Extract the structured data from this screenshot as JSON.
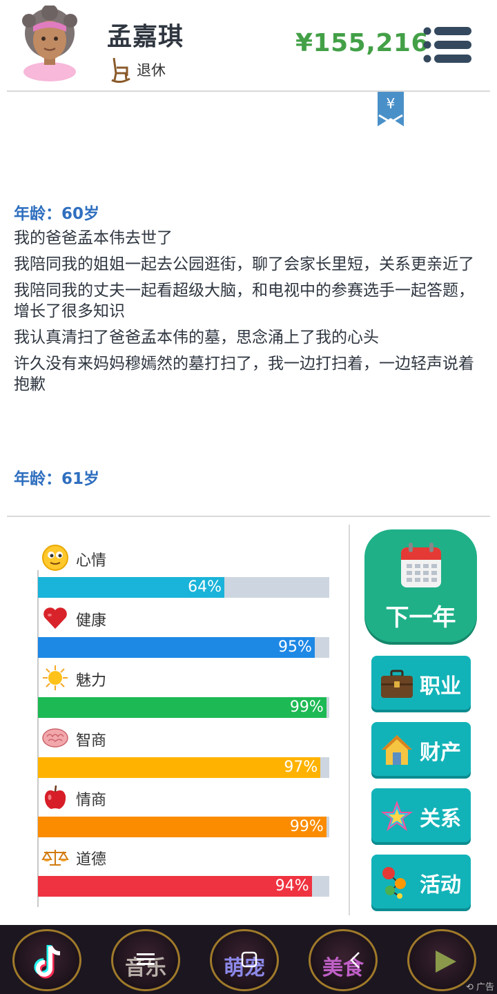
{
  "header": {
    "name": "孟嘉琪",
    "status": "退休",
    "money": "¥155,216"
  },
  "bookmark": {
    "symbol": "¥"
  },
  "log": {
    "blocks": [
      {
        "age": "年龄：60岁",
        "entries": [
          "我的爸爸孟本伟去世了",
          "我陪同我的姐姐一起去公园逛街，聊了会家长里短，关系更亲近了",
          "我陪同我的丈夫一起看超级大脑，和电视中的参赛选手一起答题，增长了很多知识",
          "我认真清扫了爸爸孟本伟的墓，思念涌上了我的心头",
          "许久没有来妈妈穆嫣然的墓打扫了，我一边打扫着，一边轻声说着抱歉"
        ]
      },
      {
        "age": "年龄：61岁"
      }
    ]
  },
  "stats": [
    {
      "label": "心情",
      "value": 64,
      "pct": "64%",
      "color": "#1ab3d9",
      "icon": "smiley-icon"
    },
    {
      "label": "健康",
      "value": 95,
      "pct": "95%",
      "color": "#1e88e5",
      "icon": "heart-icon"
    },
    {
      "label": "魅力",
      "value": 99,
      "pct": "99%",
      "color": "#1db954",
      "icon": "sun-icon"
    },
    {
      "label": "智商",
      "value": 97,
      "pct": "97%",
      "color": "#ffb300",
      "icon": "brain-icon"
    },
    {
      "label": "情商",
      "value": 99,
      "pct": "99%",
      "color": "#fb8c00",
      "icon": "apple-icon"
    },
    {
      "label": "道德",
      "value": 94,
      "pct": "94%",
      "color": "#ef3340",
      "icon": "scales-icon"
    }
  ],
  "actions": {
    "next_year": "下一年",
    "career": "职业",
    "assets": "财产",
    "relations": "关系",
    "activities": "活动"
  },
  "ad_bar": {
    "items": [
      "音乐",
      "萌宠",
      "美食"
    ],
    "tag": "广告"
  },
  "colors": {
    "age_blue": "#2f6fbf",
    "money_green": "#43a047",
    "next_button": "#1fb088",
    "side_button": "#12b3b8"
  }
}
